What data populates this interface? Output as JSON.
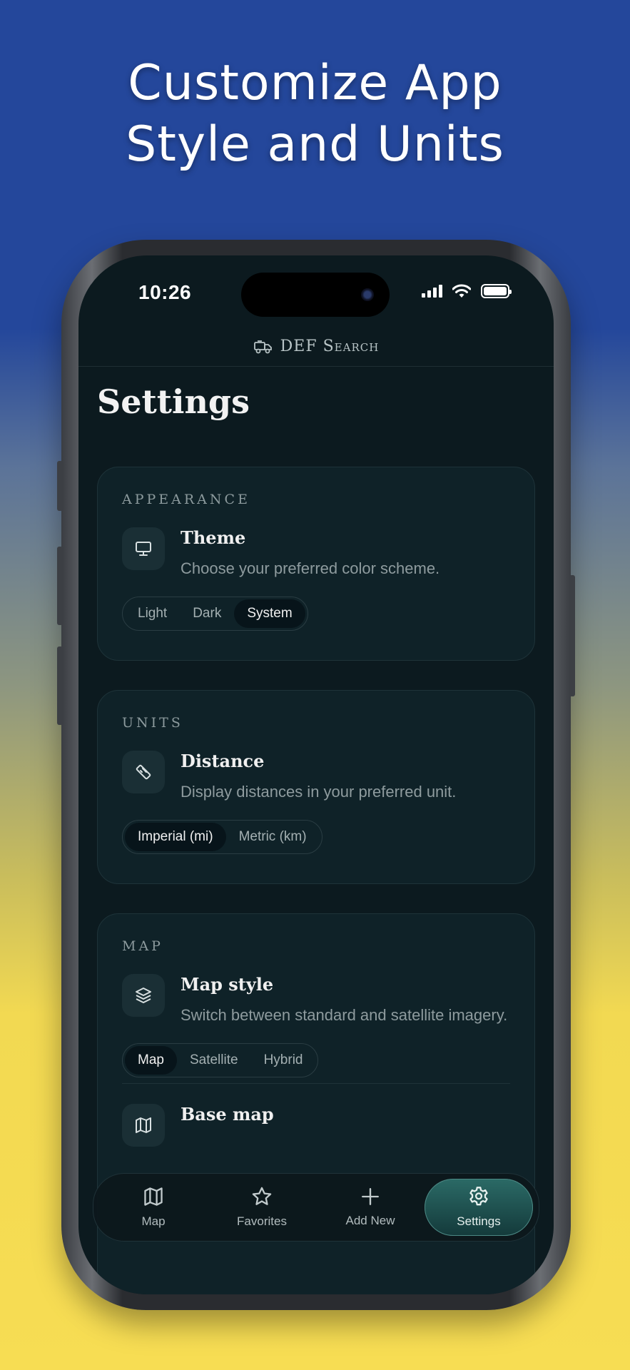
{
  "promo": {
    "headline_line1": "Customize App",
    "headline_line2": "Style and Units"
  },
  "status_bar": {
    "time": "10:26"
  },
  "app_bar": {
    "brand": "DEF Search",
    "icon": "truck-icon"
  },
  "page": {
    "title": "Settings"
  },
  "appearance": {
    "section": "APPEARANCE",
    "title": "Theme",
    "description": "Choose your preferred color scheme.",
    "icon": "monitor-icon",
    "options": [
      "Light",
      "Dark",
      "System"
    ],
    "selected": "System"
  },
  "units": {
    "section": "UNITS",
    "title": "Distance",
    "description": "Display distances in your preferred unit.",
    "icon": "ruler-icon",
    "options": [
      "Imperial (mi)",
      "Metric (km)"
    ],
    "selected": "Imperial (mi)"
  },
  "map": {
    "section": "MAP",
    "style": {
      "title": "Map style",
      "description": "Switch between standard and satellite imagery.",
      "icon": "layers-icon",
      "options": [
        "Map",
        "Satellite",
        "Hybrid"
      ],
      "selected": "Map"
    },
    "base": {
      "title": "Base map",
      "icon": "map-icon"
    }
  },
  "tabbar": {
    "items": [
      {
        "label": "Map",
        "icon": "map-icon"
      },
      {
        "label": "Favorites",
        "icon": "star-icon"
      },
      {
        "label": "Add New",
        "icon": "plus-icon"
      },
      {
        "label": "Settings",
        "icon": "gear-icon"
      }
    ],
    "active": "Settings"
  }
}
